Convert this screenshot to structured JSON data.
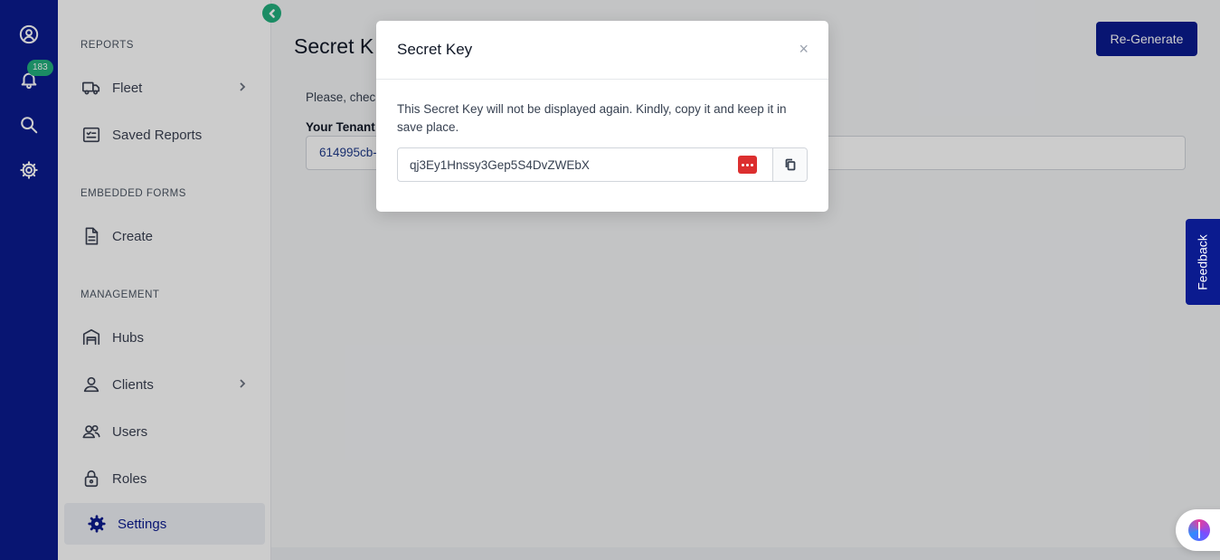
{
  "rail": {
    "notification_count": "183"
  },
  "sidebar": {
    "sections": {
      "reports": "REPORTS",
      "embedded_forms": "EMBEDDED FORMS",
      "management": "MANAGEMENT"
    },
    "items": {
      "fleet": "Fleet",
      "saved_reports": "Saved Reports",
      "create": "Create",
      "hubs": "Hubs",
      "clients": "Clients",
      "users": "Users",
      "roles": "Roles",
      "settings": "Settings"
    },
    "active_item": "Settings"
  },
  "main": {
    "title": "Secret K",
    "regenerate_label": "Re-Generate",
    "description": "Please, chec",
    "tenant_label": "Your Tenant",
    "tenant_value": "614995cb-"
  },
  "modal": {
    "title": "Secret Key",
    "close_symbol": "×",
    "message": "This Secret Key will not be displayed again. Kindly, copy it and keep it in save place.",
    "secret_key": "qj3Ey1Hnssy3Gep5S4DvZWEbX"
  },
  "feedback_label": "Feedback",
  "colors": {
    "primary": "#0b1b8f",
    "accent": "#22b07d",
    "password_manager": "#dc2f2f"
  }
}
